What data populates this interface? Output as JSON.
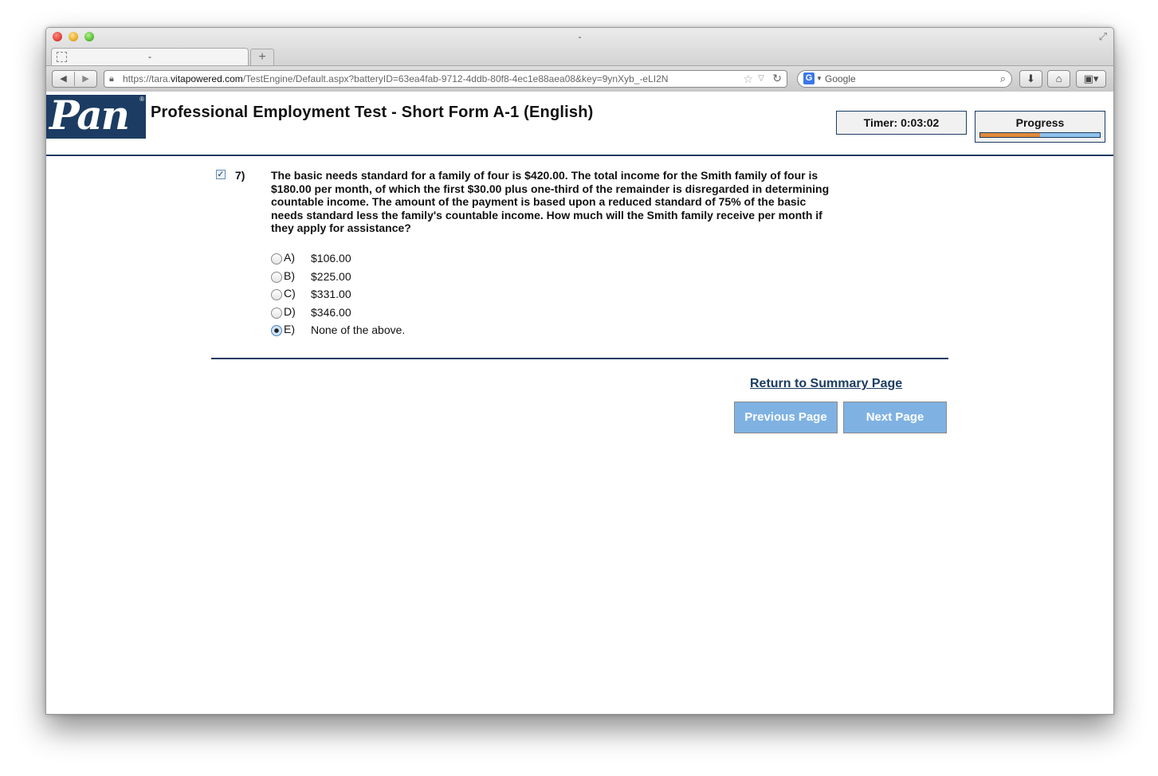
{
  "browser": {
    "window_title": "-",
    "tab_title": "-",
    "new_tab_label": "+",
    "url_prefix": "https://tara.",
    "url_host": "vitapowered.com",
    "url_rest": "/TestEngine/Default.aspx?batteryID=63ea4fab-9712-4ddb-80f8-4ec1e88aea08&key=9ynXyb_-eLI2N",
    "search_placeholder": "Google",
    "search_engine_icon": "G"
  },
  "header": {
    "logo_text": "Pan",
    "logo_mark": "®",
    "title": "Professional Employment Test - Short Form A-1 (English)",
    "timer_text": "Timer: 0:03:02",
    "progress_label": "Progress",
    "progress_fraction": 0.5
  },
  "question": {
    "number": "7)",
    "checked": true,
    "text": "The basic needs standard for a family of four is $420.00. The total income for the Smith family of four is $180.00 per month, of which the first $30.00 plus one-third of the remainder is disregarded in determining countable income. The amount of the payment is based upon a reduced standard of 75% of the basic needs standard less the family's countable income. How much will the Smith family receive per month if they apply for assistance?",
    "options": [
      {
        "letter": "A)",
        "text": "$106.00",
        "selected": false
      },
      {
        "letter": "B)",
        "text": "$225.00",
        "selected": false
      },
      {
        "letter": "C)",
        "text": "$331.00",
        "selected": false
      },
      {
        "letter": "D)",
        "text": "$346.00",
        "selected": false
      },
      {
        "letter": "E)",
        "text": "None of the above.",
        "selected": true
      }
    ]
  },
  "footer": {
    "summary_link": "Return to Summary Page",
    "previous_label": "Previous Page",
    "next_label": "Next Page"
  },
  "colors": {
    "brand_navy": "#1c3c63",
    "button_blue": "#7fb2e3",
    "progress_orange": "#e08a3b",
    "progress_track": "#8ec1ec"
  },
  "icons": [
    "close-window-icon",
    "minimize-window-icon",
    "zoom-window-icon",
    "fullscreen-icon",
    "tab-favicon",
    "back-icon",
    "forward-icon",
    "lock-icon",
    "bookmark-star-icon",
    "dropdown-icon",
    "reload-icon",
    "google-icon",
    "magnifier-icon",
    "download-icon",
    "home-icon",
    "extensions-icon",
    "checkbox-icon"
  ]
}
